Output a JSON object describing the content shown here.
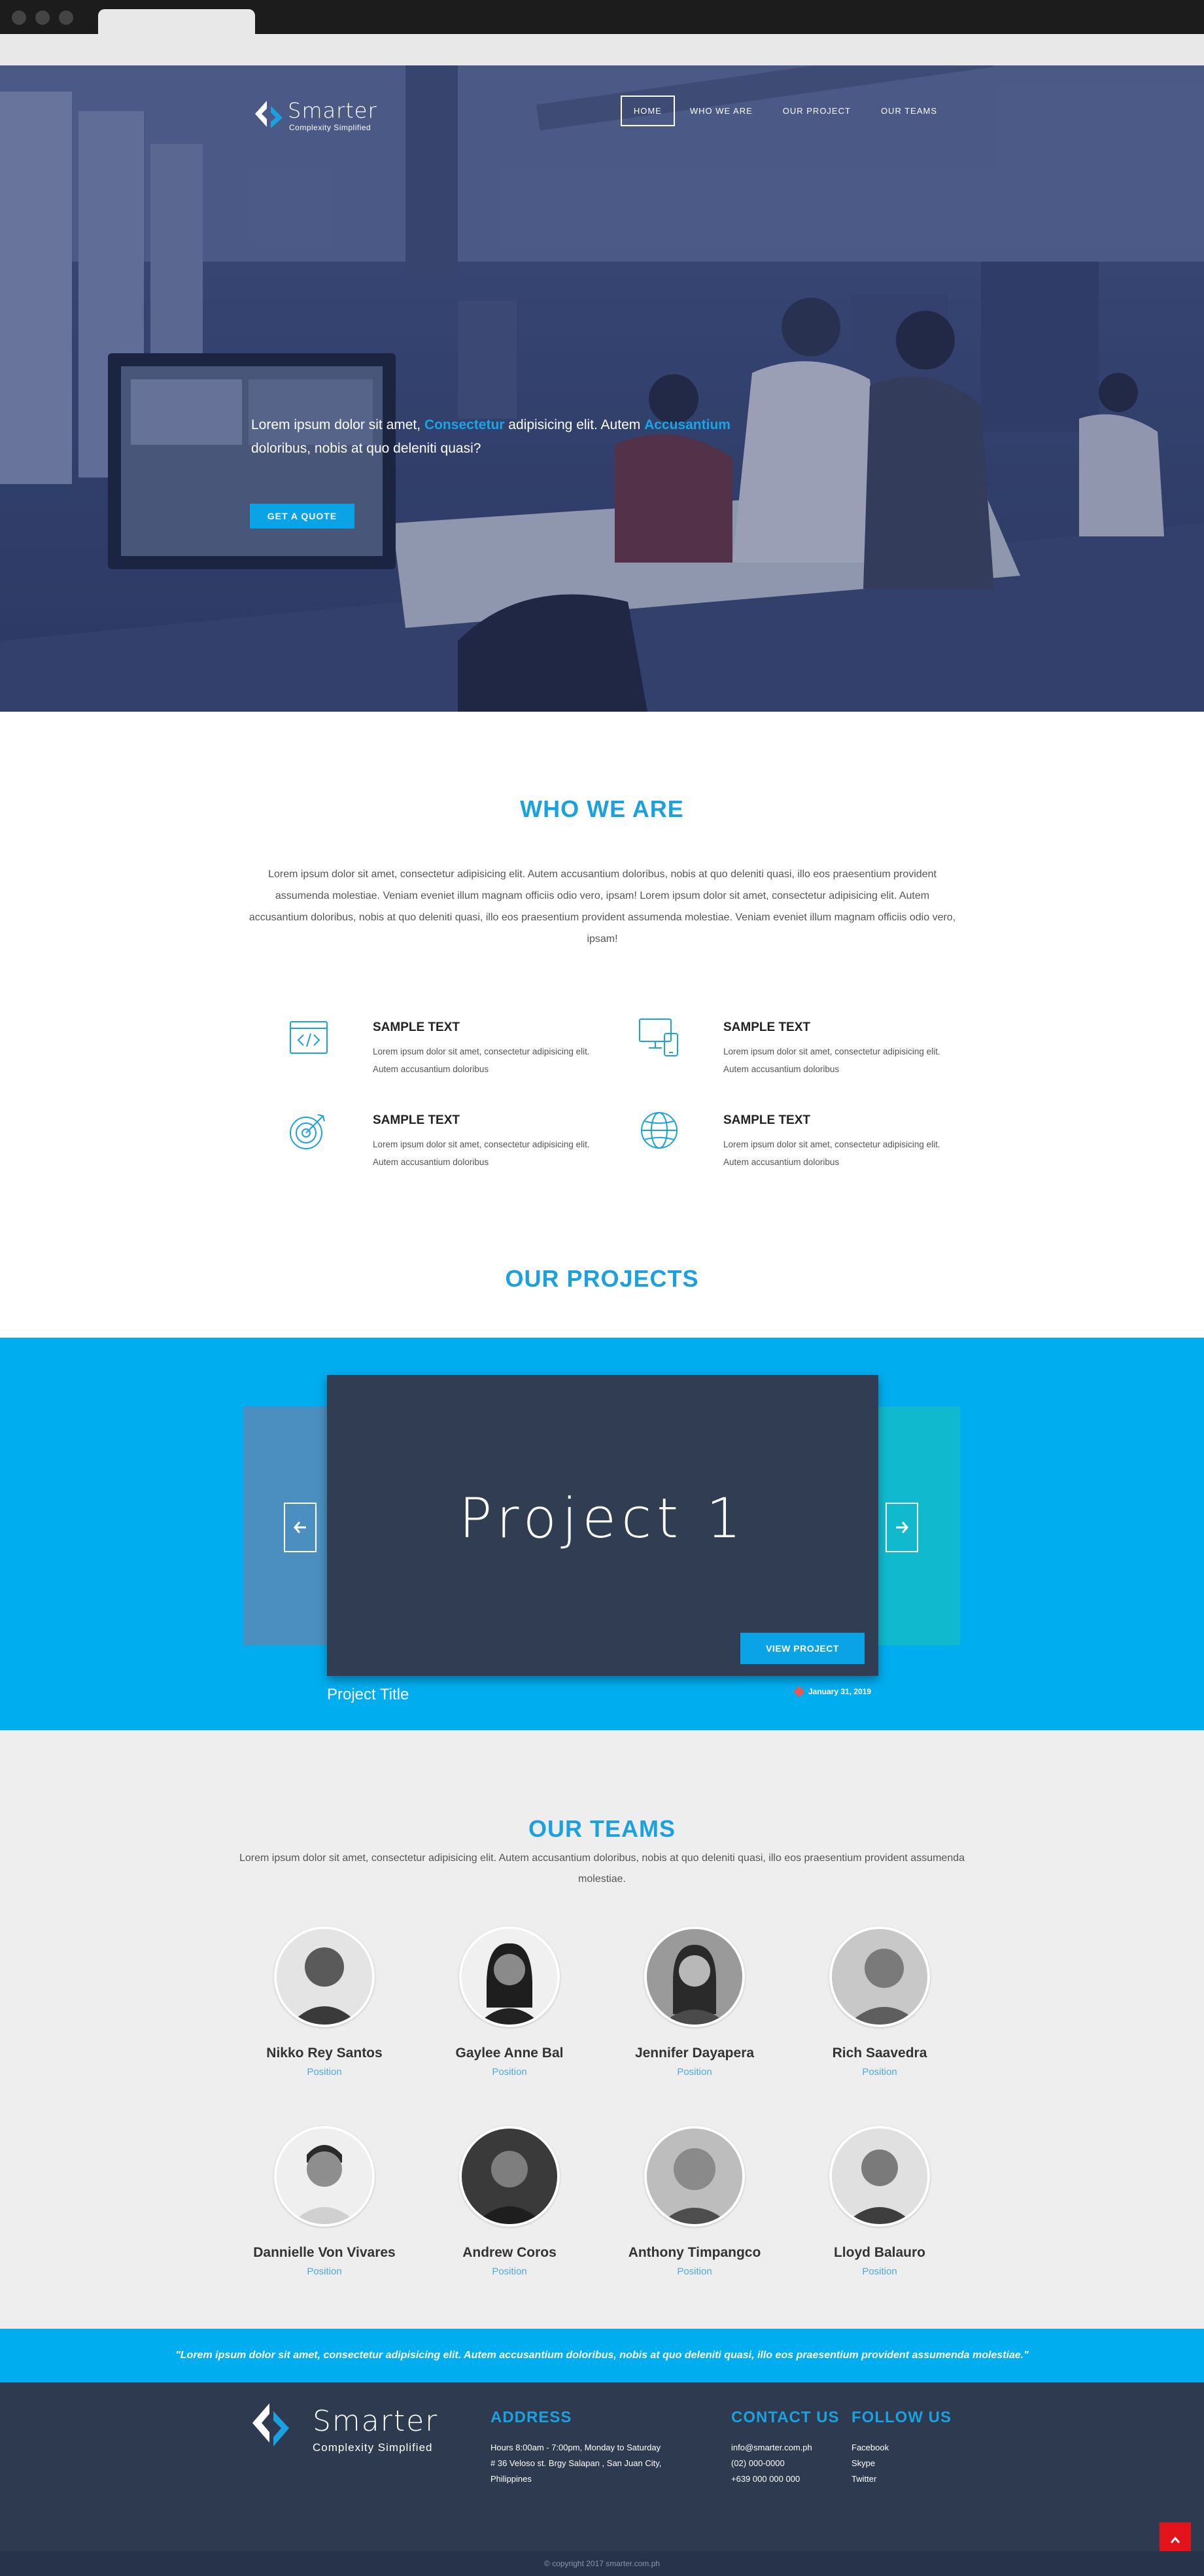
{
  "brand": {
    "name": "Smarter",
    "tagline": "Complexity Simplified"
  },
  "nav": {
    "items": [
      "HOME",
      "WHO WE ARE",
      "OUR PROJECT",
      "OUR TEAMS"
    ]
  },
  "hero": {
    "text_1": "Lorem ipsum dolor sit amet, ",
    "highlight_1": "Consectetur",
    "text_2": " adipisicing elit. Autem ",
    "highlight_2": "Accusantium",
    "text_3": " doloribus, nobis at quo deleniti quasi?",
    "cta": "GET A QUOTE"
  },
  "who": {
    "title": "WHO WE ARE",
    "body": "Lorem ipsum dolor sit amet, consectetur adipisicing elit. Autem accusantium doloribus, nobis at quo deleniti quasi, illo eos praesentium provident assumenda molestiae. Veniam eveniet illum magnam officiis odio vero, ipsam! Lorem ipsum dolor sit amet, consectetur adipisicing elit. Autem accusantium doloribus, nobis at quo deleniti quasi, illo eos praesentium provident assumenda molestiae. Veniam eveniet illum magnam officiis odio vero, ipsam!",
    "features": [
      {
        "icon": "code-window-icon",
        "title": "SAMPLE TEXT",
        "text": "Lorem ipsum dolor sit amet, consectetur adipisicing elit. Autem accusantium doloribus"
      },
      {
        "icon": "devices-icon",
        "title": "SAMPLE TEXT",
        "text": "Lorem ipsum dolor sit amet, consectetur adipisicing elit. Autem accusantium doloribus"
      },
      {
        "icon": "target-icon",
        "title": "SAMPLE TEXT",
        "text": "Lorem ipsum dolor sit amet, consectetur adipisicing elit. Autem accusantium doloribus"
      },
      {
        "icon": "globe-icon",
        "title": "SAMPLE TEXT",
        "text": "Lorem ipsum dolor sit amet, consectetur adipisicing elit. Autem accusantium doloribus"
      }
    ]
  },
  "projects": {
    "title": "OUR PROJECTS",
    "card_title": "Project 1",
    "view_button": "VIEW PROJECT",
    "project_title": "Project Title",
    "date": "January 31, 2019"
  },
  "teams": {
    "title": "OUR TEAMS",
    "body": "Lorem ipsum dolor sit amet, consectetur adipisicing elit. Autem accusantium doloribus, nobis at quo deleniti quasi, illo eos praesentium provident assumenda molestiae.",
    "members": [
      {
        "name": "Nikko Rey Santos",
        "position": "Position"
      },
      {
        "name": "Gaylee Anne Bal",
        "position": "Position"
      },
      {
        "name": "Jennifer Dayapera",
        "position": "Position"
      },
      {
        "name": "Rich Saavedra",
        "position": "Position"
      },
      {
        "name": "Dannielle Von Vivares",
        "position": "Position"
      },
      {
        "name": "Andrew Coros",
        "position": "Position"
      },
      {
        "name": "Anthony Timpangco",
        "position": "Position"
      },
      {
        "name": "Lloyd Balauro",
        "position": "Position"
      }
    ]
  },
  "quote": "\"Lorem ipsum dolor sit amet, consectetur adipisicing elit. Autem accusantium doloribus, nobis at quo deleniti quasi, illo eos praesentium provident assumenda molestiae.\"",
  "footer": {
    "address": {
      "title": "ADDRESS",
      "lines": [
        "Hours 8:00am - 7:00pm, Monday to Saturday",
        "# 36 Veloso st. Brgy Salapan , San Juan City,",
        "Philippines"
      ]
    },
    "contact": {
      "title": "CONTACT US",
      "lines": [
        "info@smarter.com.ph",
        "(02) 000-0000",
        "+639 000 000 000"
      ]
    },
    "follow": {
      "title": "FOLLOW US",
      "lines": [
        "Facebook",
        "Skype",
        "Twitter"
      ]
    },
    "copyright": "© copyright 2017 smarter.com.ph"
  },
  "colors": {
    "accent": "#00adef",
    "heading": "#1ba1df",
    "dark": "#2e3a4f",
    "top_button": "#e2131a"
  }
}
